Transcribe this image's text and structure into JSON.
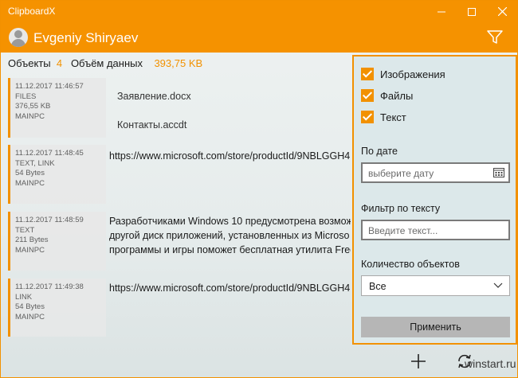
{
  "window": {
    "title": "ClipboardX",
    "minimize_icon": "minimize-icon",
    "maximize_icon": "maximize-icon",
    "close_icon": "close-icon"
  },
  "header": {
    "user_name": "Evgeniy Shiryaev",
    "filter_icon": "filter-icon"
  },
  "stats": {
    "objects_label": "Объекты",
    "objects_count": "4",
    "size_label": "Объём данных",
    "size_value": "393,75 KB"
  },
  "items": [
    {
      "datetime": "11.12.2017 11:46:57",
      "type": "FILES",
      "size": "376,55 KB",
      "source": "MAINPC",
      "lines": [
        "Заявление.docx",
        "Контакты.accdt"
      ]
    },
    {
      "datetime": "11.12.2017 11:48:45",
      "type": "TEXT, LINK",
      "size": "54 Bytes",
      "source": "MAINPC",
      "lines": [
        "https://www.microsoft.com/store/productId/9NBLGGH4"
      ]
    },
    {
      "datetime": "11.12.2017 11:48:59",
      "type": "TEXT",
      "size": "211 Bytes",
      "source": "MAINPC",
      "lines": [
        "Разработчиками Windows 10 предусмотрена возмож",
        "другой диск приложений, установленных из Microso",
        "программы и игры поможет бесплатная утилита Free"
      ]
    },
    {
      "datetime": "11.12.2017 11:49:38",
      "type": "LINK",
      "size": "54 Bytes",
      "source": "MAINPC",
      "lines": [
        "https://www.microsoft.com/store/productId/9NBLGGH4"
      ]
    }
  ],
  "filter": {
    "checkboxes": [
      {
        "label": "Изображения",
        "checked": true
      },
      {
        "label": "Файлы",
        "checked": true
      },
      {
        "label": "Текст",
        "checked": true
      }
    ],
    "date_label": "По дате",
    "date_placeholder": "выберите дату",
    "text_label": "Фильтр по тексту",
    "text_placeholder": "Введите текст...",
    "count_label": "Количество объектов",
    "count_value": "Все",
    "apply_label": "Применить"
  },
  "bottom": {
    "add_icon": "plus-icon",
    "refresh_icon": "refresh-icon",
    "watermark": "winstart.ru"
  },
  "colors": {
    "accent": "#f59200"
  }
}
